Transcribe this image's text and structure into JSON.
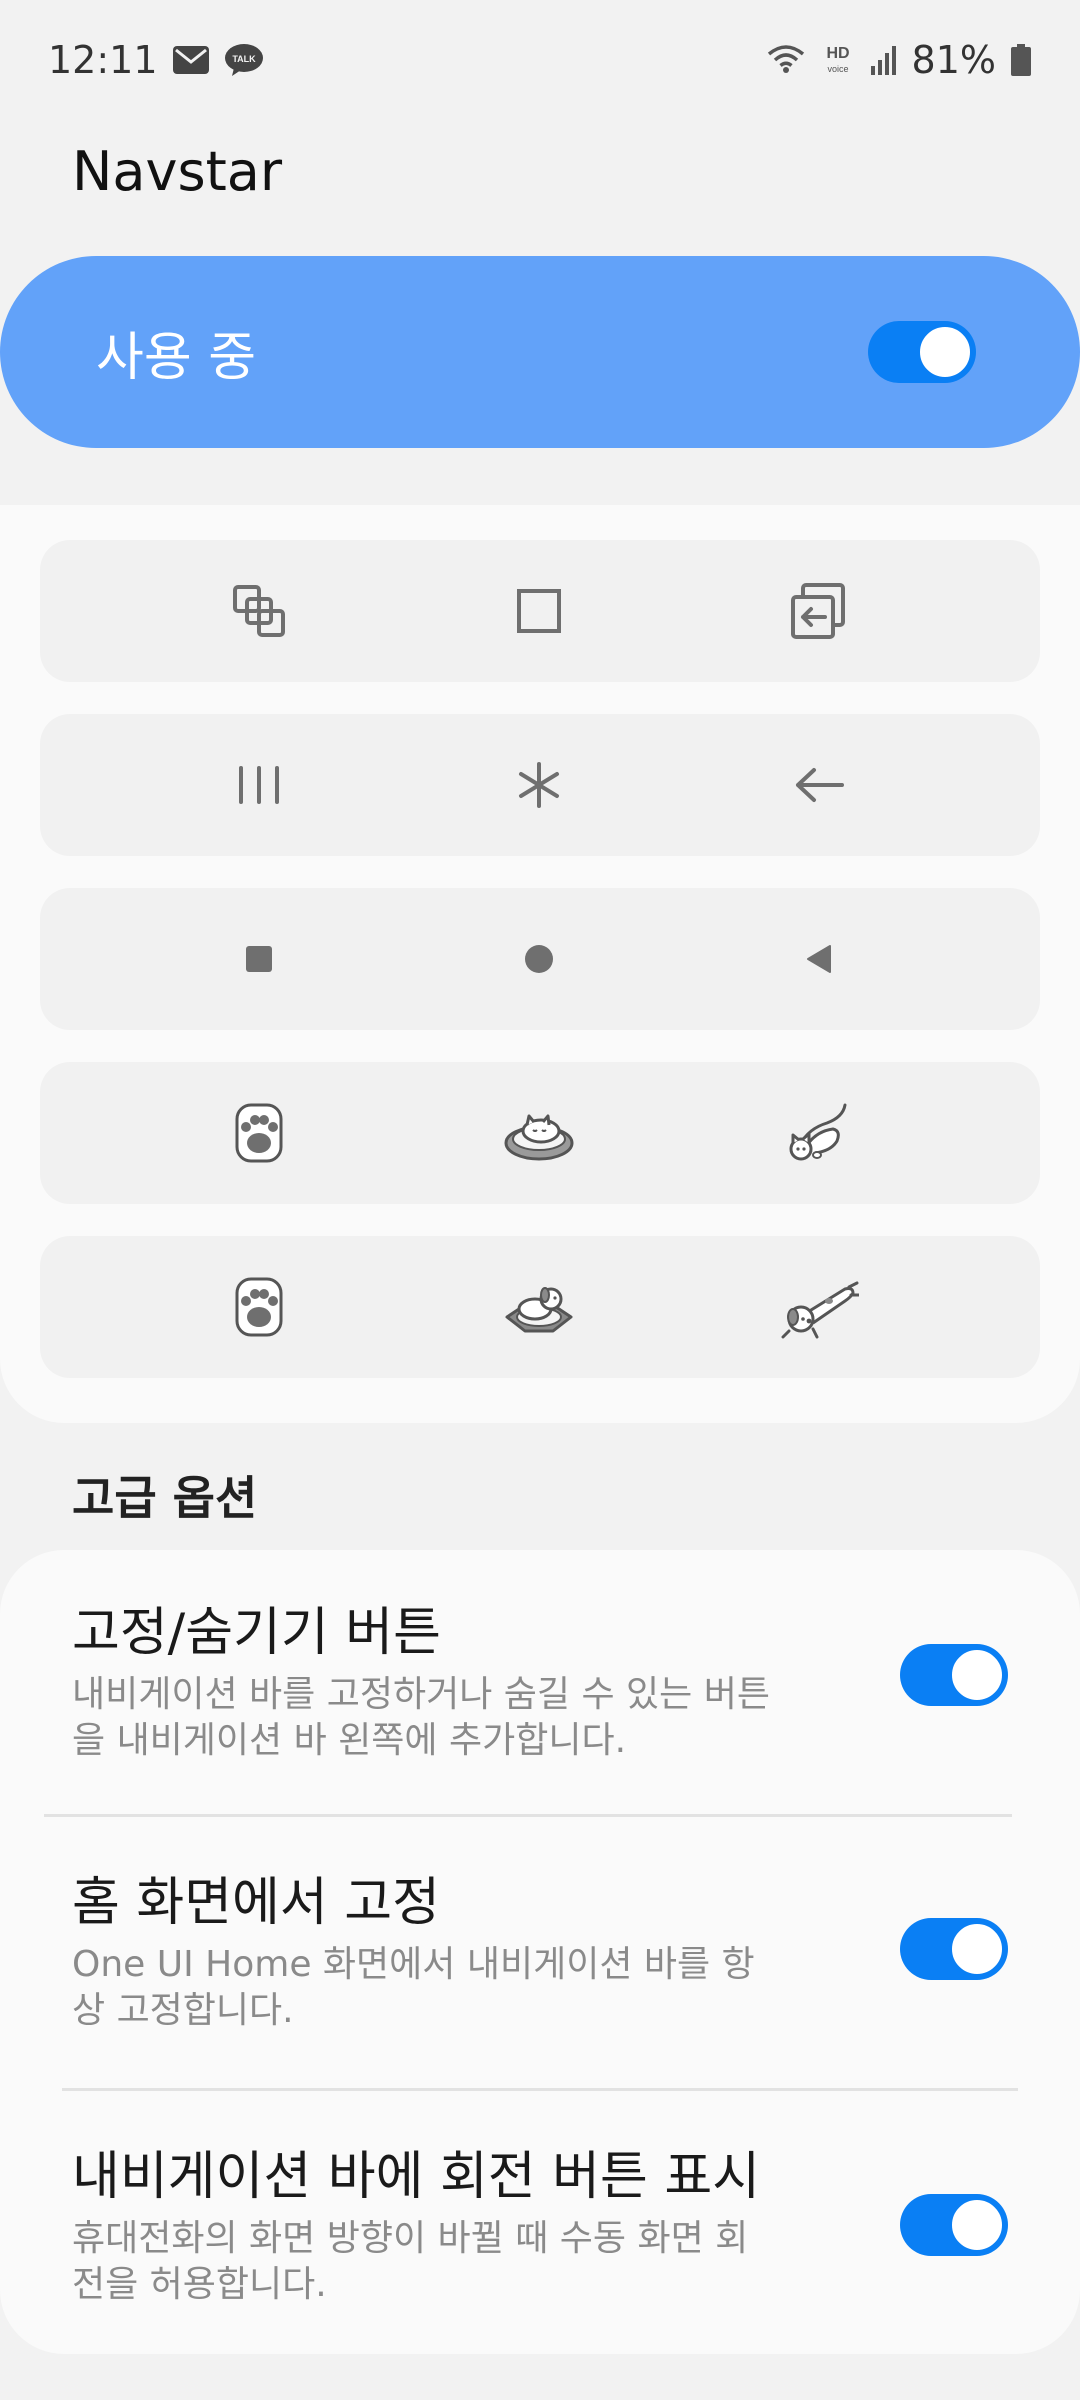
{
  "status_bar": {
    "time": "12:11",
    "battery_percent": "81%",
    "notification_icons": [
      "mail-icon",
      "kakaotalk-icon"
    ],
    "system_icons": [
      "wifi-icon",
      "hd-voice-icon",
      "signal-icon",
      "battery-icon"
    ],
    "hd_voice_label": "HD",
    "voice_sublabel": "voice",
    "talk_label": "TALK"
  },
  "app": {
    "title": "Navstar"
  },
  "master_switch": {
    "label": "사용 중",
    "enabled": true,
    "accent_color": "#62a2f9"
  },
  "button_styles": [
    {
      "icons": [
        "recents-overlap-icon",
        "home-square-outline-icon",
        "back-box-arrow-icon"
      ]
    },
    {
      "icons": [
        "recents-lines-icon",
        "home-asterisk-icon",
        "back-arrow-icon"
      ]
    },
    {
      "icons": [
        "recents-filled-square-icon",
        "home-filled-circle-icon",
        "back-filled-triangle-icon"
      ]
    },
    {
      "icons": [
        "cat-paw-icon",
        "cat-sleeping-bed-icon",
        "cat-stretching-icon"
      ]
    },
    {
      "icons": [
        "dog-paw-icon",
        "dog-sleeping-bed-icon",
        "dog-lying-icon"
      ]
    }
  ],
  "advanced": {
    "header": "고급 옵션",
    "items": [
      {
        "title": "고정/숨기기 버튼",
        "description": "내비게이션 바를 고정하거나 숨길 수 있는 버튼을 내비게이션 바 왼쪽에 추가합니다.",
        "enabled": true
      },
      {
        "title": "홈 화면에서 고정",
        "description": "One UI Home 화면에서 내비게이션 바를 항상 고정합니다.",
        "enabled": true
      },
      {
        "title": "내비게이션 바에 회전 버튼 표시",
        "description": "휴대전화의 화면 방향이 바뀔 때 수동 화면 회전을 허용합니다.",
        "enabled": true
      }
    ]
  },
  "colors": {
    "toggle_on": "#0a7ff4",
    "icon_gray": "#6f6f6f"
  }
}
